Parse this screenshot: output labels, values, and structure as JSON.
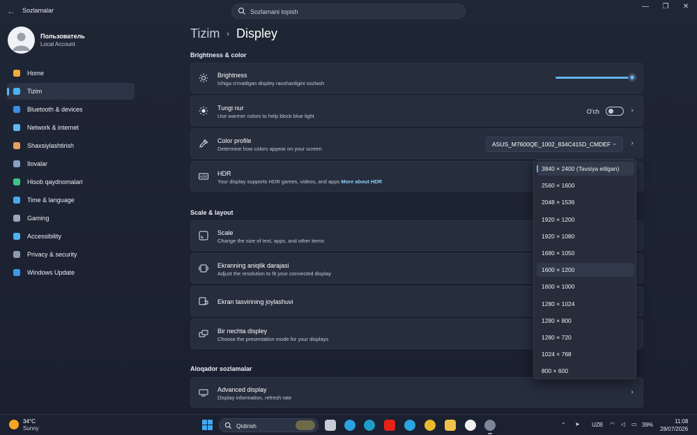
{
  "window": {
    "app_title": "Sozlamalar",
    "search_placeholder": "Sozlamani topish",
    "minimize": "—",
    "maximize": "❐",
    "close": "✕",
    "back": "←"
  },
  "profile": {
    "name": "Пользователь",
    "subtitle": "Local Account"
  },
  "nav": [
    {
      "label": "Home",
      "icon": "home-icon",
      "color": "#f2a83b"
    },
    {
      "label": "Tizim",
      "icon": "system-icon",
      "color": "#4cb2f0",
      "active": true
    },
    {
      "label": "Bluetooth & devices",
      "icon": "bluetooth-icon",
      "color": "#3a8ee6"
    },
    {
      "label": "Network & internet",
      "icon": "wifi-icon",
      "color": "#5fb8f3"
    },
    {
      "label": "Shaxsiylashtirish",
      "icon": "brush-icon",
      "color": "#e6a15a"
    },
    {
      "label": "Ilovalar",
      "icon": "apps-icon",
      "color": "#8aa0c4"
    },
    {
      "label": "Hisob qaydnomalari",
      "icon": "account-icon",
      "color": "#3cc48a"
    },
    {
      "label": "Time & language",
      "icon": "globe-icon",
      "color": "#4aa8ec"
    },
    {
      "label": "Gaming",
      "icon": "gamepad-icon",
      "color": "#9aa6ba"
    },
    {
      "label": "Accessibility",
      "icon": "accessibility-icon",
      "color": "#4db3f0"
    },
    {
      "label": "Privacy & security",
      "icon": "shield-icon",
      "color": "#8d99ad"
    },
    {
      "label": "Windows Update",
      "icon": "update-icon",
      "color": "#3d9ae8"
    }
  ],
  "breadcrumb": {
    "parent": "Tizim",
    "current": "Displey"
  },
  "sections": {
    "brightness": "Brightness & color",
    "scale": "Scale & layout",
    "related": "Aloqador sozlamalar"
  },
  "cards": {
    "brightness": {
      "title": "Brightness",
      "subtitle": "Ichiga o'rnatilgan displey ravshanligini sozlash",
      "value": 1.0
    },
    "night": {
      "title": "Tungi nur",
      "subtitle": "Use warmer colors to help block blue light",
      "state": "O'ch"
    },
    "color_profile": {
      "title": "Color profile",
      "subtitle": "Determine how colors appear on your screen",
      "value": "ASUS_M7600QE_1002_834C415D_CMDEF"
    },
    "hdr": {
      "title": "HDR",
      "subtitle": "Your display supports HDR games, videos, and apps",
      "link": "More about HDR"
    },
    "scale": {
      "title": "Scale",
      "subtitle": "Change the size of text, apps, and other items"
    },
    "resolution": {
      "title": "Ekranning aniqlik darajasi",
      "subtitle": "Adjust the resolution to fit your connected display"
    },
    "orientation": {
      "title": "Ekran tasvirining joylashuvi"
    },
    "multiple": {
      "title": "Bir nechta displey",
      "subtitle": "Choose the presentation mode for your displays"
    },
    "advanced": {
      "title": "Advanced display",
      "subtitle": "Display information, refresh rate"
    }
  },
  "resolutions": [
    "3840 × 2400 (Tavsiya etilgan)",
    "2560 × 1600",
    "2048 × 1536",
    "1920 × 1200",
    "1920 × 1080",
    "1680 × 1050",
    "1600 × 1200",
    "1600 × 1000",
    "1280 × 1024",
    "1280 × 800",
    "1280 × 720",
    "1024 × 768",
    "800 × 600"
  ],
  "taskbar": {
    "temp": "34°C",
    "weather": "Sunny",
    "search": "Qidirish",
    "lang": "UZB",
    "battery": "39%",
    "time": "11:08",
    "date": "28/07/2026"
  }
}
